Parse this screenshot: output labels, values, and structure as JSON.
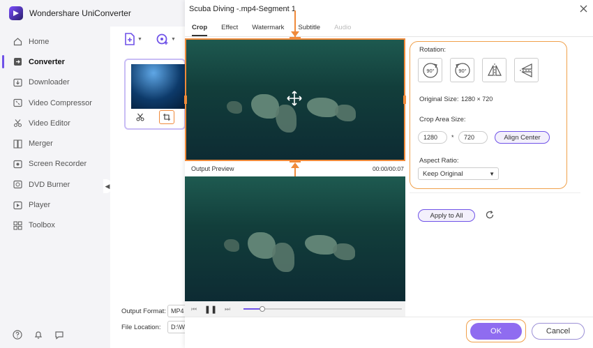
{
  "app": {
    "title": "Wondershare UniConverter"
  },
  "sidebar": {
    "items": [
      {
        "label": "Home",
        "icon": "home-icon"
      },
      {
        "label": "Converter",
        "icon": "converter-icon",
        "active": true
      },
      {
        "label": "Downloader",
        "icon": "download-icon"
      },
      {
        "label": "Video Compressor",
        "icon": "compress-icon"
      },
      {
        "label": "Video Editor",
        "icon": "scissors-icon"
      },
      {
        "label": "Merger",
        "icon": "merge-icon"
      },
      {
        "label": "Screen Recorder",
        "icon": "record-icon"
      },
      {
        "label": "DVD Burner",
        "icon": "disc-icon"
      },
      {
        "label": "Player",
        "icon": "play-icon"
      },
      {
        "label": "Toolbox",
        "icon": "grid-icon"
      }
    ]
  },
  "converter": {
    "output_format_label": "Output Format:",
    "output_format_value": "MP4",
    "file_location_label": "File Location:",
    "file_location_value": "D:\\W"
  },
  "dialog": {
    "title": "Scuba Diving -.mp4-Segment 1",
    "tabs": [
      {
        "label": "Crop",
        "active": true
      },
      {
        "label": "Effect"
      },
      {
        "label": "Watermark"
      },
      {
        "label": "Subtitle"
      },
      {
        "label": "Audio",
        "disabled": true
      }
    ],
    "preview": {
      "label": "Output Preview",
      "time": "00:00/00:07",
      "progress": 0.12
    },
    "settings": {
      "rotation_label": "Rotation:",
      "rotate_right_label": "90°",
      "rotate_left_label": "90°",
      "original_size_label": "Original Size:",
      "original_size_value": "1280 × 720",
      "crop_area_label": "Crop Area Size:",
      "crop_width": "1280",
      "crop_height": "720",
      "times": "*",
      "align_center": "Align Center",
      "aspect_ratio_label": "Aspect Ratio:",
      "aspect_ratio_value": "Keep Original"
    },
    "apply_all": "Apply to All",
    "ok": "OK",
    "cancel": "Cancel"
  },
  "colors": {
    "accent": "#6f52e8",
    "highlight": "#f08a3a",
    "ok_bg": "#8f6cf0"
  }
}
